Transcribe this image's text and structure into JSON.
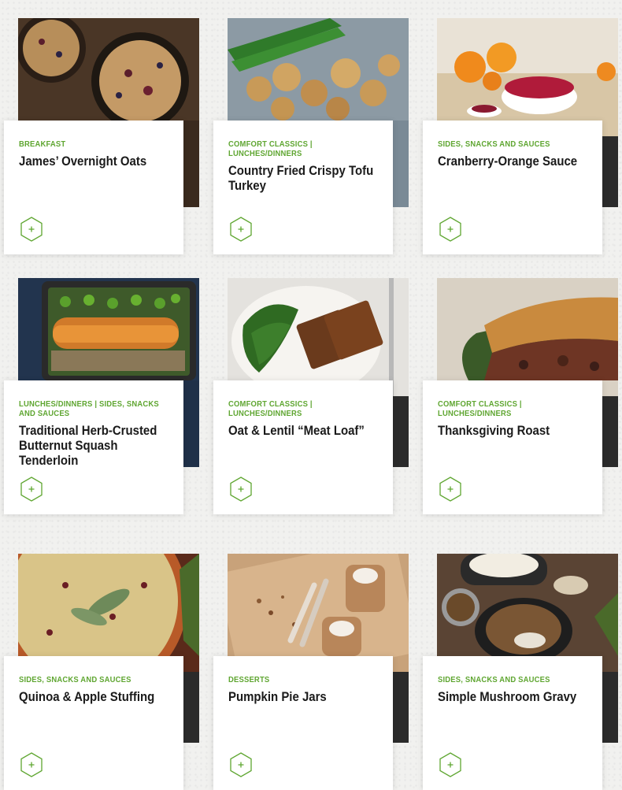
{
  "recipes": [
    {
      "category": "Breakfast",
      "title": "James’ Overnight Oats",
      "add_icon": "plus-hexagon-icon"
    },
    {
      "category": "Comfort Classics | Lunches/Dinners",
      "title": "Country Fried Crispy Tofu Turkey",
      "add_icon": "plus-hexagon-icon"
    },
    {
      "category": "Sides, Snacks and Sauces",
      "title": "Cranberry-Orange Sauce",
      "add_icon": "plus-hexagon-icon"
    },
    {
      "category": "Lunches/Dinners | Sides, Snacks and Sauces",
      "title": "Traditional Herb-Crusted Butternut Squash Tenderloin",
      "add_icon": "plus-hexagon-icon"
    },
    {
      "category": "Comfort Classics | Lunches/Dinners",
      "title": "Oat & Lentil “Meat Loaf”",
      "add_icon": "plus-hexagon-icon"
    },
    {
      "category": "Comfort Classics | Lunches/Dinners",
      "title": "Thanksgiving Roast",
      "add_icon": "plus-hexagon-icon"
    },
    {
      "category": "Sides, Snacks and Sauces",
      "title": "Quinoa & Apple Stuffing",
      "add_icon": "plus-hexagon-icon"
    },
    {
      "category": "Desserts",
      "title": "Pumpkin Pie Jars",
      "add_icon": "plus-hexagon-icon"
    },
    {
      "category": "Sides, Snacks and Sauces",
      "title": "Simple Mushroom Gravy",
      "add_icon": "plus-hexagon-icon"
    }
  ],
  "colors": {
    "accent": "#5fa631",
    "title": "#1a1a1a",
    "card": "#ffffff",
    "photo_backing": "#2b2b2b"
  }
}
